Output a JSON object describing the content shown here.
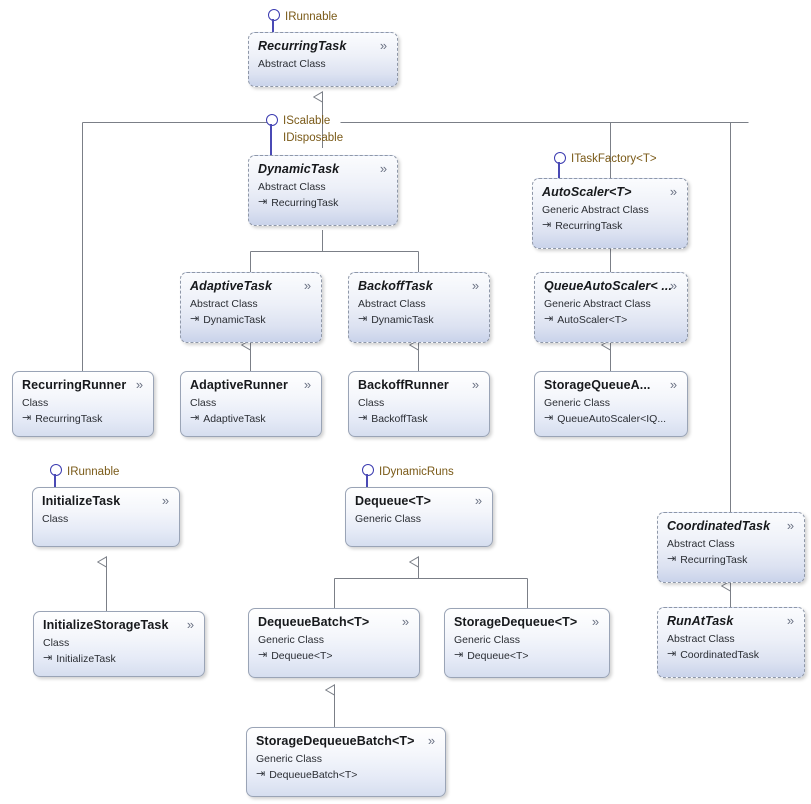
{
  "diagram": {
    "title": "UML Class Diagram",
    "background_color": "#ffffff",
    "line_color": "#7b7f87",
    "interface_color": "#3b3bb0",
    "interface_label_color": "#7a5a18",
    "expand_icon": "chevron-down-double-icon",
    "inherit_glyph": "→",
    "kinds": {
      "class": "Class",
      "abstract_class": "Abstract Class",
      "generic_class": "Generic Class",
      "generic_abstract_class": "Generic Abstract Class"
    }
  },
  "nodes": [
    {
      "id": "recurring-task",
      "title": "RecurringTask",
      "kind": "Abstract Class",
      "base": "",
      "abstract": true,
      "expand": "»"
    },
    {
      "id": "dynamic-task",
      "title": "DynamicTask",
      "kind": "Abstract Class",
      "base": "RecurringTask",
      "abstract": true,
      "expand": "»"
    },
    {
      "id": "auto-scaler",
      "title": "AutoScaler<T>",
      "kind": "Generic Abstract Class",
      "base": "RecurringTask",
      "abstract": true,
      "expand": "»"
    },
    {
      "id": "adaptive-task",
      "title": "AdaptiveTask",
      "kind": "Abstract Class",
      "base": "DynamicTask",
      "abstract": true,
      "expand": "»"
    },
    {
      "id": "backoff-task",
      "title": "BackoffTask",
      "kind": "Abstract Class",
      "base": "DynamicTask",
      "abstract": true,
      "expand": "»"
    },
    {
      "id": "queue-auto-scaler",
      "title": "QueueAutoScaler< ...",
      "kind": "Generic Abstract Class",
      "base": "AutoScaler<T>",
      "abstract": true,
      "expand": "»"
    },
    {
      "id": "recurring-runner",
      "title": "RecurringRunner",
      "kind": "Class",
      "base": "RecurringTask",
      "abstract": false,
      "expand": "»"
    },
    {
      "id": "adaptive-runner",
      "title": "AdaptiveRunner",
      "kind": "Class",
      "base": "AdaptiveTask",
      "abstract": false,
      "expand": "»"
    },
    {
      "id": "backoff-runner",
      "title": "BackoffRunner",
      "kind": "Class",
      "base": "BackoffTask",
      "abstract": false,
      "expand": "»"
    },
    {
      "id": "storage-queue-auto-scaler",
      "title": "StorageQueueA...",
      "kind": "Generic Class",
      "base": "QueueAutoScaler<IQ...",
      "abstract": false,
      "expand": "»"
    },
    {
      "id": "initialize-task",
      "title": "InitializeTask",
      "kind": "Class",
      "base": "",
      "abstract": false,
      "expand": "»"
    },
    {
      "id": "dequeue",
      "title": "Dequeue<T>",
      "kind": "Generic Class",
      "base": "",
      "abstract": false,
      "expand": "»"
    },
    {
      "id": "coordinated-task",
      "title": "CoordinatedTask",
      "kind": "Abstract Class",
      "base": "RecurringTask",
      "abstract": true,
      "expand": "»"
    },
    {
      "id": "initialize-storage-task",
      "title": "InitializeStorageTask",
      "kind": "Class",
      "base": "InitializeTask",
      "abstract": false,
      "expand": "»"
    },
    {
      "id": "dequeue-batch",
      "title": "DequeueBatch<T>",
      "kind": "Generic Class",
      "base": "Dequeue<T>",
      "abstract": false,
      "expand": "»"
    },
    {
      "id": "storage-dequeue",
      "title": "StorageDequeue<T>",
      "kind": "Generic Class",
      "base": "Dequeue<T>",
      "abstract": false,
      "expand": "»"
    },
    {
      "id": "run-at-task",
      "title": "RunAtTask",
      "kind": "Abstract Class",
      "base": "CoordinatedTask",
      "abstract": true,
      "expand": "»"
    },
    {
      "id": "storage-dequeue-batch",
      "title": "StorageDequeueBatch<T>",
      "kind": "Generic Class",
      "base": "DequeueBatch<T>",
      "abstract": false,
      "expand": "»"
    }
  ],
  "interfaces": [
    {
      "id": "irunnable-top",
      "label": "IRunnable",
      "sublabel": ""
    },
    {
      "id": "iscalable",
      "label": "IScalable",
      "sublabel": "IDisposable"
    },
    {
      "id": "itaskfactory",
      "label": "ITaskFactory<T>",
      "sublabel": ""
    },
    {
      "id": "irunnable-init",
      "label": "IRunnable",
      "sublabel": ""
    },
    {
      "id": "idynamicruns",
      "label": "IDynamicRuns",
      "sublabel": ""
    }
  ]
}
